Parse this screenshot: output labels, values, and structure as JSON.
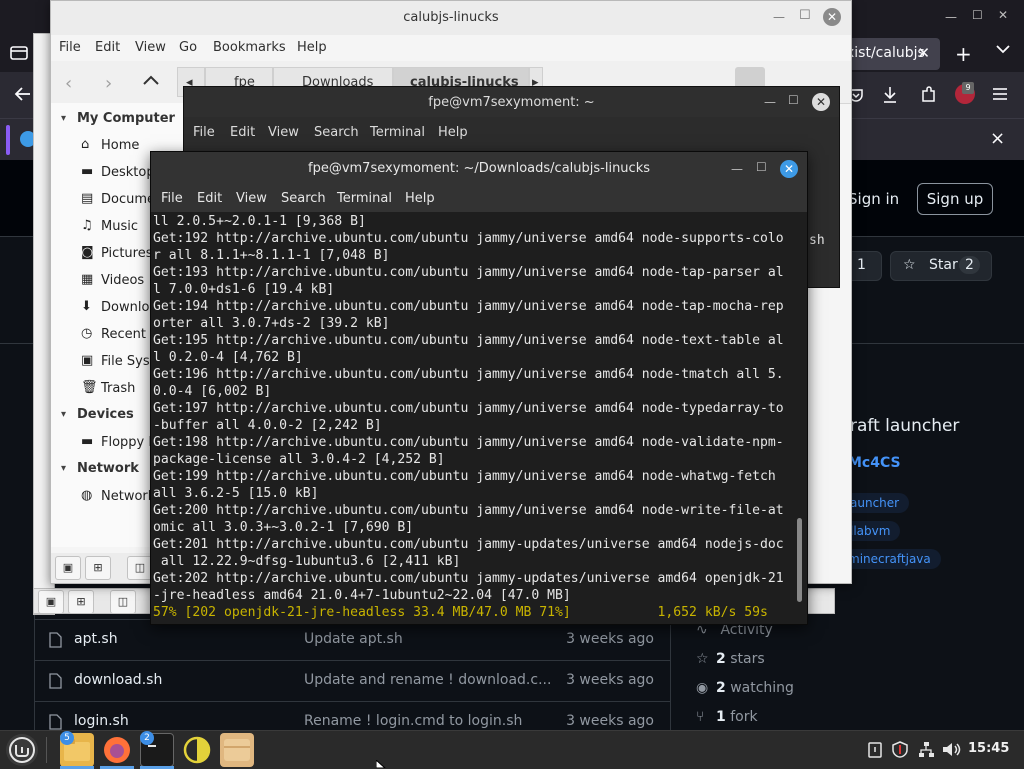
{
  "browser": {
    "tab_title": "xist/calubjs",
    "notification_close": "×",
    "github": {
      "sign_in": "Sign in",
      "sign_up": "Sign up",
      "fork_count": "1",
      "star_label": "Star",
      "star_count": "2",
      "about_fragment": "raft launcher",
      "link_fragment": "Mc4CS",
      "topics": [
        "auncher",
        "llabvm",
        "minecraftjava"
      ],
      "files": [
        {
          "name": "apt.sh",
          "message": "Update apt.sh",
          "age": "3 weeks ago"
        },
        {
          "name": "download.sh",
          "message": "Update and rename ! download.c...",
          "age": "3 weeks ago"
        },
        {
          "name": "login.sh",
          "message": "Rename ! login.cmd to login.sh",
          "age": "3 weeks ago"
        }
      ],
      "stats": [
        {
          "icon": "activity-icon",
          "bold": "",
          "label": "Activity"
        },
        {
          "icon": "star-icon",
          "bold": "2",
          "label": "stars"
        },
        {
          "icon": "eye-icon",
          "bold": "2",
          "label": "watching"
        },
        {
          "icon": "fork-icon",
          "bold": "1",
          "label": "fork"
        }
      ]
    },
    "extensions_badge": "9"
  },
  "file_manager": {
    "title": "calubjs-linucks",
    "menu": [
      "File",
      "Edit",
      "View",
      "Go",
      "Bookmarks",
      "Help"
    ],
    "breadcrumbs": [
      "fpe",
      "Downloads",
      "calubjs-linucks"
    ],
    "sidebar": {
      "my_computer": "My Computer",
      "computer_items": [
        "Home",
        "Desktop",
        "Documents",
        "Music",
        "Pictures",
        "Videos",
        "Downloads",
        "Recent",
        "File System",
        "Trash"
      ],
      "devices": "Devices",
      "device_items": [
        "Floppy Disk"
      ],
      "network": "Network",
      "network_items": [
        "Network"
      ]
    }
  },
  "terminal_back": {
    "title": "fpe@vm7sexymoment: ~",
    "menu": [
      "File",
      "Edit",
      "View",
      "Search",
      "Terminal",
      "Help"
    ],
    "overflow": "sh"
  },
  "terminal_front": {
    "title": "fpe@vm7sexymoment: ~/Downloads/calubjs-linucks",
    "menu": [
      "File",
      "Edit",
      "View",
      "Search",
      "Terminal",
      "Help"
    ],
    "lines": [
      "ll 2.0.5+~2.0.1-1 [9,368 B]",
      "Get:192 http://archive.ubuntu.com/ubuntu jammy/universe amd64 node-supports-colo",
      "r all 8.1.1+~8.1.1-1 [7,048 B]",
      "Get:193 http://archive.ubuntu.com/ubuntu jammy/universe amd64 node-tap-parser al",
      "l 7.0.0+ds1-6 [19.4 kB]",
      "Get:194 http://archive.ubuntu.com/ubuntu jammy/universe amd64 node-tap-mocha-rep",
      "orter all 3.0.7+ds-2 [39.2 kB]",
      "Get:195 http://archive.ubuntu.com/ubuntu jammy/universe amd64 node-text-table al",
      "l 0.2.0-4 [4,762 B]",
      "Get:196 http://archive.ubuntu.com/ubuntu jammy/universe amd64 node-tmatch all 5.",
      "0.0-4 [6,002 B]",
      "Get:197 http://archive.ubuntu.com/ubuntu jammy/universe amd64 node-typedarray-to",
      "-buffer all 4.0.0-2 [2,242 B]",
      "Get:198 http://archive.ubuntu.com/ubuntu jammy/universe amd64 node-validate-npm-",
      "package-license all 3.0.4-2 [4,252 B]",
      "Get:199 http://archive.ubuntu.com/ubuntu jammy/universe amd64 node-whatwg-fetch",
      "all 3.6.2-5 [15.0 kB]",
      "Get:200 http://archive.ubuntu.com/ubuntu jammy/universe amd64 node-write-file-at",
      "omic all 3.0.3+~3.0.2-1 [7,690 B]",
      "Get:201 http://archive.ubuntu.com/ubuntu jammy-updates/universe amd64 nodejs-doc",
      " all 12.22.9~dfsg-1ubuntu3.6 [2,411 kB]",
      "Get:202 http://archive.ubuntu.com/ubuntu jammy-updates/universe amd64 openjdk-21",
      "-jre-headless amd64 21.0.4+7-1ubuntu2~22.04 [47.0 MB]"
    ],
    "progress_line": "57% [202 openjdk-21-jre-headless 33.4 MB/47.0 MB 71%]           1,652 kB/s 59s"
  },
  "taskbar": {
    "badge_files": "5",
    "badge_terminal": "2",
    "clock": "15:45"
  },
  "colors": {
    "mint_green": "#87cf3e",
    "terminal_close": "#3d9ae6",
    "progress_yellow": "#c8b400"
  }
}
